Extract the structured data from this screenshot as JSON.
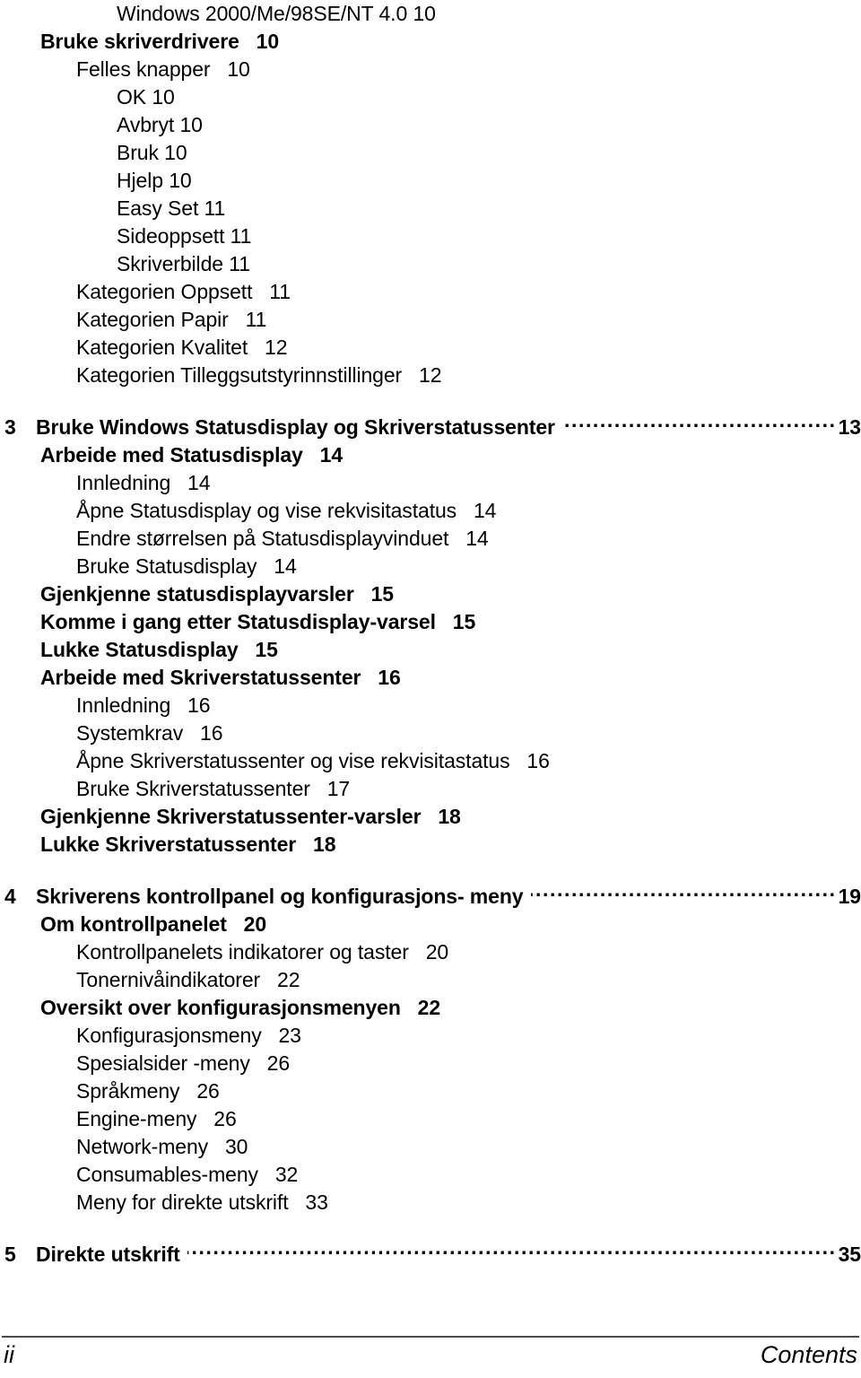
{
  "document": {
    "type": "table-of-contents",
    "language": "no"
  },
  "toc": {
    "entries": [
      {
        "level": 4,
        "label": "Windows 2000/Me/98SE/NT 4.0 10",
        "bold": false,
        "leader": false
      },
      {
        "level": 2,
        "label": "Bruke skriverdrivere",
        "page": "10",
        "bold": true,
        "leader": false
      },
      {
        "level": 3,
        "label": "Felles knapper",
        "page": "10",
        "bold": false,
        "leader": false
      },
      {
        "level": 4,
        "label": "OK 10",
        "bold": false,
        "leader": false
      },
      {
        "level": 4,
        "label": "Avbryt 10",
        "bold": false,
        "leader": false
      },
      {
        "level": 4,
        "label": "Bruk 10",
        "bold": false,
        "leader": false
      },
      {
        "level": 4,
        "label": "Hjelp 10",
        "bold": false,
        "leader": false
      },
      {
        "level": 4,
        "label": "Easy Set 11",
        "bold": false,
        "leader": false
      },
      {
        "level": 4,
        "label": "Sideoppsett 11",
        "bold": false,
        "leader": false
      },
      {
        "level": 4,
        "label": "Skriverbilde 11",
        "bold": false,
        "leader": false
      },
      {
        "level": 3,
        "label": "Kategorien Oppsett",
        "page": "11",
        "bold": false,
        "leader": false
      },
      {
        "level": 3,
        "label": "Kategorien Papir",
        "page": "11",
        "bold": false,
        "leader": false
      },
      {
        "level": 3,
        "label": "Kategorien Kvalitet",
        "page": "12",
        "bold": false,
        "leader": false
      },
      {
        "level": 3,
        "label": "Kategorien Tilleggsutstyrinnstillinger",
        "page": "12",
        "bold": false,
        "leader": false
      },
      {
        "spacer": true
      },
      {
        "level": 1,
        "chapter": "3",
        "label": "Bruke Windows Statusdisplay og Skriverstatussenter",
        "page": "13",
        "bold": true,
        "leader": true
      },
      {
        "level": 2,
        "label": "Arbeide med Statusdisplay",
        "page": "14",
        "bold": true,
        "leader": false
      },
      {
        "level": 3,
        "label": "Innledning",
        "page": "14",
        "bold": false,
        "leader": false
      },
      {
        "level": 3,
        "label": "Åpne Statusdisplay og vise rekvisitastatus",
        "page": "14",
        "bold": false,
        "leader": false
      },
      {
        "level": 3,
        "label": "Endre størrelsen på Statusdisplayvinduet",
        "page": "14",
        "bold": false,
        "leader": false
      },
      {
        "level": 3,
        "label": "Bruke Statusdisplay",
        "page": "14",
        "bold": false,
        "leader": false
      },
      {
        "level": 2,
        "label": "Gjenkjenne statusdisplayvarsler",
        "page": "15",
        "bold": true,
        "leader": false
      },
      {
        "level": 2,
        "label": "Komme i gang etter Statusdisplay-varsel",
        "page": "15",
        "bold": true,
        "leader": false
      },
      {
        "level": 2,
        "label": "Lukke Statusdisplay",
        "page": "15",
        "bold": true,
        "leader": false
      },
      {
        "level": 2,
        "label": "Arbeide med Skriverstatussenter",
        "page": "16",
        "bold": true,
        "leader": false
      },
      {
        "level": 3,
        "label": "Innledning",
        "page": "16",
        "bold": false,
        "leader": false
      },
      {
        "level": 3,
        "label": "Systemkrav",
        "page": "16",
        "bold": false,
        "leader": false
      },
      {
        "level": 3,
        "label": "Åpne Skriverstatussenter og vise rekvisitastatus",
        "page": "16",
        "bold": false,
        "leader": false
      },
      {
        "level": 3,
        "label": "Bruke Skriverstatussenter",
        "page": "17",
        "bold": false,
        "leader": false
      },
      {
        "level": 2,
        "label": "Gjenkjenne Skriverstatussenter-varsler",
        "page": "18",
        "bold": true,
        "leader": false
      },
      {
        "level": 2,
        "label": "Lukke Skriverstatussenter",
        "page": "18",
        "bold": true,
        "leader": false
      },
      {
        "spacer": true
      },
      {
        "level": 1,
        "chapter": "4",
        "label": "Skriverens kontrollpanel og konfigurasjons- meny",
        "page": "19",
        "bold": true,
        "leader": true
      },
      {
        "level": 2,
        "label": "Om kontrollpanelet",
        "page": "20",
        "bold": true,
        "leader": false
      },
      {
        "level": 3,
        "label": "Kontrollpanelets indikatorer og taster",
        "page": "20",
        "bold": false,
        "leader": false
      },
      {
        "level": 3,
        "label": "Tonernivåindikatorer",
        "page": "22",
        "bold": false,
        "leader": false
      },
      {
        "level": 2,
        "label": "Oversikt over konfigurasjonsmenyen",
        "page": "22",
        "bold": true,
        "leader": false
      },
      {
        "level": 3,
        "label": "Konfigurasjonsmeny",
        "page": "23",
        "bold": false,
        "leader": false
      },
      {
        "level": 3,
        "label": "Spesialsider -meny",
        "page": "26",
        "bold": false,
        "leader": false
      },
      {
        "level": 3,
        "label": "Språkmeny",
        "page": "26",
        "bold": false,
        "leader": false
      },
      {
        "level": 3,
        "label": "Engine-meny",
        "page": "26",
        "bold": false,
        "leader": false
      },
      {
        "level": 3,
        "label": "Network-meny",
        "page": "30",
        "bold": false,
        "leader": false
      },
      {
        "level": 3,
        "label": "Consumables-meny",
        "page": "32",
        "bold": false,
        "leader": false
      },
      {
        "level": 3,
        "label": "Meny for direkte utskrift",
        "page": "33",
        "bold": false,
        "leader": false
      },
      {
        "spacer": true
      },
      {
        "level": 1,
        "chapter": "5",
        "label": "Direkte utskrift",
        "page": "35",
        "bold": true,
        "leader": true
      }
    ]
  },
  "footer": {
    "page_label": "ii",
    "section_label": "Contents"
  }
}
